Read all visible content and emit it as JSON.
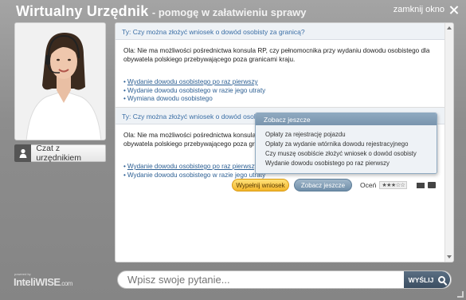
{
  "window": {
    "title_main": "Wirtualny Urzędnik",
    "title_sub": "- pomogę w załatwieniu sprawy",
    "close_label": "zamknij okno"
  },
  "sidebar": {
    "chat_label": "Czat z urzędnikiem"
  },
  "conversation": [
    {
      "question": "Ty: Czy można złożyć wniosek o dowód osobisty za granicą?",
      "answer": "Ola: Nie ma możliwości pośrednictwa konsula RP, czy pełnomocnika przy wydaniu dowodu osobistego dla obywatela polskiego przebywającego poza granicami kraju.",
      "links": [
        "Wydanie dowodu osobistego po raz pierwszy",
        "Wydanie dowodu osobistego w razie jego utraty",
        "Wymiana dowodu osobistego"
      ]
    },
    {
      "question": "Ty: Czy można złożyć wniosek o dowód osobisty za granicą?",
      "answer": "Ola: Nie ma możliwości pośrednictwa konsula RP, czy pełnomocnika przy wydaniu dowodu osobistego dla obywatela polskiego przebywającego poza granicami kraju.",
      "links": [
        "Wydanie dowodu osobistego po raz pierwszy",
        "Wydanie dowodu osobistego w razie jego utraty"
      ]
    }
  ],
  "actions": {
    "fill_form": "Wypełnij wniosek",
    "see_more": "Zobacz jeszcze",
    "rate": "Oceń",
    "rating": 3
  },
  "popup": {
    "title": "Zobacz jeszcze",
    "items": [
      "Opłaty za rejestrację pojazdu",
      "Opłaty za wydanie wtórnika dowodu rejestracyjnego",
      "Czy muszę osobiście złożyć wniosek o dowód osobisty",
      "Wydanie dowodu osobistego po raz pierwszy"
    ]
  },
  "search": {
    "placeholder": "Wpisz swoje pytanie...",
    "button": "WYŚLIJ"
  },
  "brand": {
    "powered": "powered by",
    "logo": "InteliWISE",
    "suffix": ".com"
  }
}
